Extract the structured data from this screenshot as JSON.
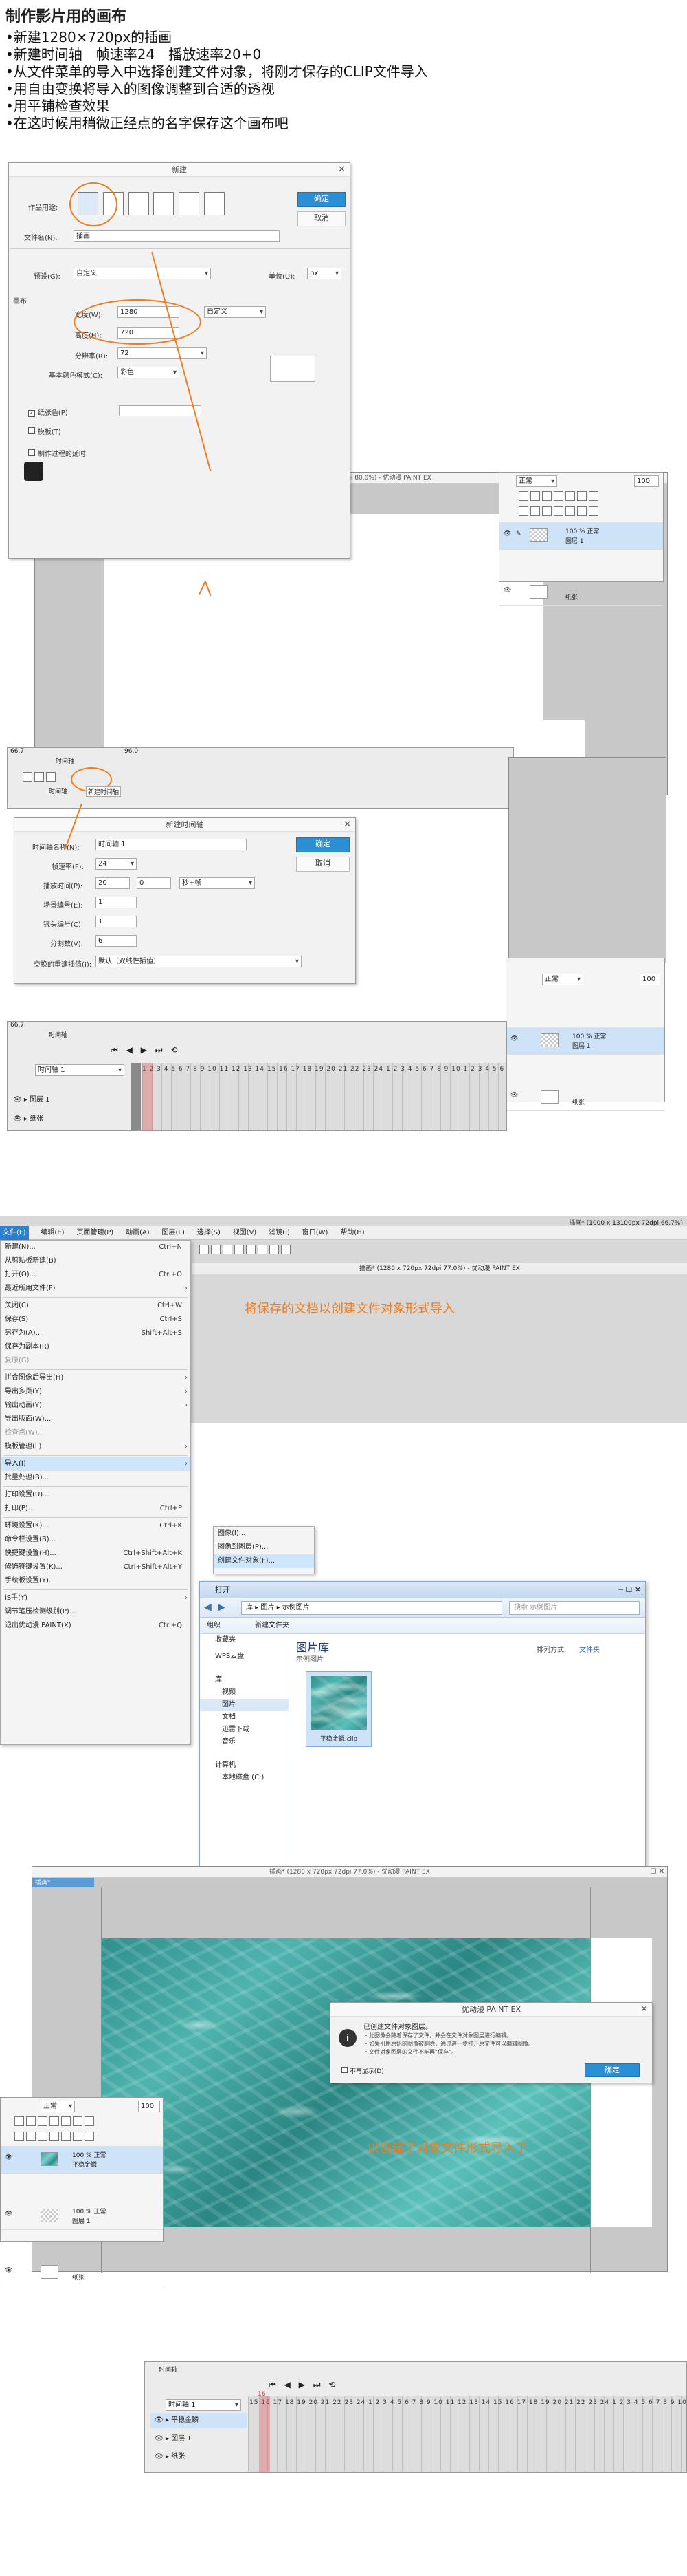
{
  "intro": {
    "title": "制作影片用的画布",
    "steps": [
      "新建1280×720px的插画",
      "新建时间轴　帧速率24　播放速率20+0",
      "从文件菜单的导入中选择创建文件对象，将刚才保存的CLIP文件导入",
      "用自由变换将导入的图像调整到合适的透视",
      "用平铺检查效果",
      "在这时候用稍微正经点的名字保存这个画布吧"
    ]
  },
  "new_dialog": {
    "title": "新建",
    "usage_label": "作品用途:",
    "filename_label": "文件名(N):",
    "filename_value": "插画",
    "preset_label": "预设(G):",
    "preset_value": "自定义",
    "unit_label": "单位(U):",
    "unit_value": "px",
    "canvas_group": "画布",
    "width_label": "宽度(W):",
    "width_value": "1280",
    "height_label": "高度(H):",
    "height_value": "720",
    "size_preset": "自定义",
    "resolution_label": "分辨率(R):",
    "resolution_value": "72",
    "color_mode_label": "基本颜色模式(C):",
    "color_mode_value": "彩色",
    "paper_color_label": "纸张色(P)",
    "template_label": "模板(T)",
    "timelapse_label": "制作过程的延时",
    "ok": "确定",
    "cancel": "取消"
  },
  "canvas_window1": {
    "title": "插画* (1280 x 720px 72dpi 80.0%) - 优动漫 PAINT EX"
  },
  "layer_panel": {
    "blend_mode": "正常",
    "opacity": "100",
    "layer1_opacity": "100 % 正常",
    "layer1_name": "图层 1",
    "paper_name": "纸张"
  },
  "timeline_small": {
    "title": "时间轴",
    "tab_timeline": "时间轴",
    "tab_new": "新建时间轴",
    "status_left": "66.7",
    "status_mid": "96.0"
  },
  "new_timeline_dialog": {
    "title": "新建时间轴",
    "name_label": "时间轴名称(N):",
    "name_value": "时间轴 1",
    "fps_label": "帧速率(F):",
    "fps_value": "24",
    "play_label": "播放时间(P):",
    "play_value1": "20",
    "play_value2": "0",
    "play_unit": "秒+帧",
    "scene_label": "场景编号(E):",
    "scene_value": "1",
    "cut_label": "镜头编号(C):",
    "cut_value": "1",
    "split_label": "分割数(V):",
    "split_value": "6",
    "interp_label": "交换的重建插值(I):",
    "interp_value": "默认（双线性插值）",
    "ok": "确定",
    "cancel": "取消"
  },
  "timeline_big": {
    "title": "时间轴",
    "timeline_name": "时间轴 1",
    "track_layer1": "图层 1",
    "track_paper": "纸张",
    "frame_numbers": "1 2 3 4 5 6 7 8 9 10 11 12 13 14 15 16 17 18 19 20 21 22 23 24 1 2 3 4 5 6 7 8 9 10 1 2 3 4 5 6 7 8 9 10 11 12 13 14 15 16 17 18 19 20 21 22 23 24 1 2 3 4 5 6 7 8 9",
    "status_left": "66.7"
  },
  "main_app": {
    "title": "插画* (1000 x 13100px 72dpi 66.7%)",
    "canvas_title": "插画* (1280 x 720px 72dpi 77.0%) - 优动漫 PAINT EX",
    "menus": [
      "文件(F)",
      "编辑(E)",
      "页面管理(P)",
      "动画(A)",
      "图层(L)",
      "选择(S)",
      "视图(V)",
      "滤镜(I)",
      "窗口(W)",
      "帮助(H)"
    ],
    "annotation": "将保存的文档以创建文件对象形式导入"
  },
  "file_menu": {
    "items": [
      {
        "label": "新建(N)...",
        "shortcut": "Ctrl+N"
      },
      {
        "label": "从剪贴板新建(B)",
        "shortcut": ""
      },
      {
        "label": "打开(O)...",
        "shortcut": "Ctrl+O"
      },
      {
        "label": "最近所用文件(F)",
        "shortcut": ""
      },
      {
        "label": "关闭(C)",
        "shortcut": "Ctrl+W"
      },
      {
        "label": "保存(S)",
        "shortcut": "Ctrl+S"
      },
      {
        "label": "另存为(A)...",
        "shortcut": "Shift+Alt+S"
      },
      {
        "label": "保存为副本(R)",
        "shortcut": ""
      },
      {
        "label": "复原(G)",
        "shortcut": ""
      },
      {
        "label": "拼合图像后导出(H)",
        "shortcut": ""
      },
      {
        "label": "导出多页(Y)",
        "shortcut": ""
      },
      {
        "label": "输出动画(Y)",
        "shortcut": ""
      },
      {
        "label": "导出版面(W)...",
        "shortcut": ""
      },
      {
        "label": "检查点(W)...",
        "shortcut": ""
      },
      {
        "label": "模板管理(L)",
        "shortcut": ""
      },
      {
        "label": "导入(I)",
        "shortcut": ""
      },
      {
        "label": "批量处理(B)...",
        "shortcut": ""
      },
      {
        "label": "打印设置(U)...",
        "shortcut": ""
      },
      {
        "label": "打印(P)...",
        "shortcut": "Ctrl+P"
      },
      {
        "label": "环境设置(K)...",
        "shortcut": "Ctrl+K"
      },
      {
        "label": "命令栏设置(B)...",
        "shortcut": ""
      },
      {
        "label": "快捷键设置(H)...",
        "shortcut": "Ctrl+Shift+Alt+K"
      },
      {
        "label": "修饰符键设置(K)...",
        "shortcut": "Ctrl+Shift+Alt+Y"
      },
      {
        "label": "手绘板设置(Y)...",
        "shortcut": ""
      },
      {
        "label": "iS手(Y)",
        "shortcut": ""
      },
      {
        "label": "调节笔压检测级别(P)...",
        "shortcut": ""
      },
      {
        "label": "退出优动漫 PAINT(X)",
        "shortcut": "Ctrl+Q"
      }
    ]
  },
  "import_submenu": {
    "items": [
      "图像(I)...",
      "图像到图层(P)...",
      "创建文件对象(F)..."
    ]
  },
  "open_dialog": {
    "title": "打开",
    "path": [
      "库",
      "图片",
      "示例图片"
    ],
    "search_placeholder": "搜索 示例图片",
    "organize": "组织",
    "new_folder": "新建文件夹",
    "library_title": "图片库",
    "library_sub": "示例图片",
    "arrange_label": "排列方式:",
    "arrange_value": "文件夹",
    "sidebar": [
      "收藏夹",
      "WPS云盘",
      "库",
      "视频",
      "图片",
      "文档",
      "迅雷下载",
      "音乐",
      "计算机",
      "本地磁盘 (C:)"
    ],
    "file_name": "平稳金鳞.clip"
  },
  "canvas_window2": {
    "title": "插画* (1280 x 720px 72dpi 77.0%) - 优动漫 PAINT EX",
    "tab": "插画*"
  },
  "info_dialog": {
    "title": "优动漫 PAINT EX",
    "heading": "已创建文件对象图层。",
    "line1": "・此图像会随着保存了文件，并会在文件对象图层进行编辑。",
    "line2": "・如果引用原始的图像被删除，通过进一步打开原文件可以编辑图像。",
    "line3": "・文件对象图层的文件不能再“保存”。",
    "checkbox": "不再显示(D)",
    "ok": "确定"
  },
  "layer_panel2": {
    "blend_mode": "正常",
    "opacity": "100",
    "obj_opacity": "100 % 正常",
    "obj_name": "平稳金鳞",
    "layer1_opacity": "100 % 正常",
    "layer1_name": "图层 1",
    "paper_name": "纸张"
  },
  "annotation2": "以创建了对象文件形式导入了",
  "timeline_final": {
    "title": "时间轴",
    "timeline_name": "时间轴 1",
    "track_obj": "平稳金鳞",
    "track_layer1": "图层 1",
    "track_paper": "纸张",
    "frame_numbers": "15 16 17 18 19 20 21 22 23 24 1 2 3 4 5 6 7 8 9 10 11 12 13 14 15 16 17 18 19 20 21 22 23 24 1 2 3 4 5 6 7 8 9 10 11 12 13",
    "cursor_frame": "16"
  },
  "colors": {
    "accent_orange": "#f07c1e",
    "button_blue": "#2b8fd6",
    "selection_blue": "#cfe3f8",
    "playhead_red": "#e05050",
    "water_teal": "#3aa3a0"
  }
}
